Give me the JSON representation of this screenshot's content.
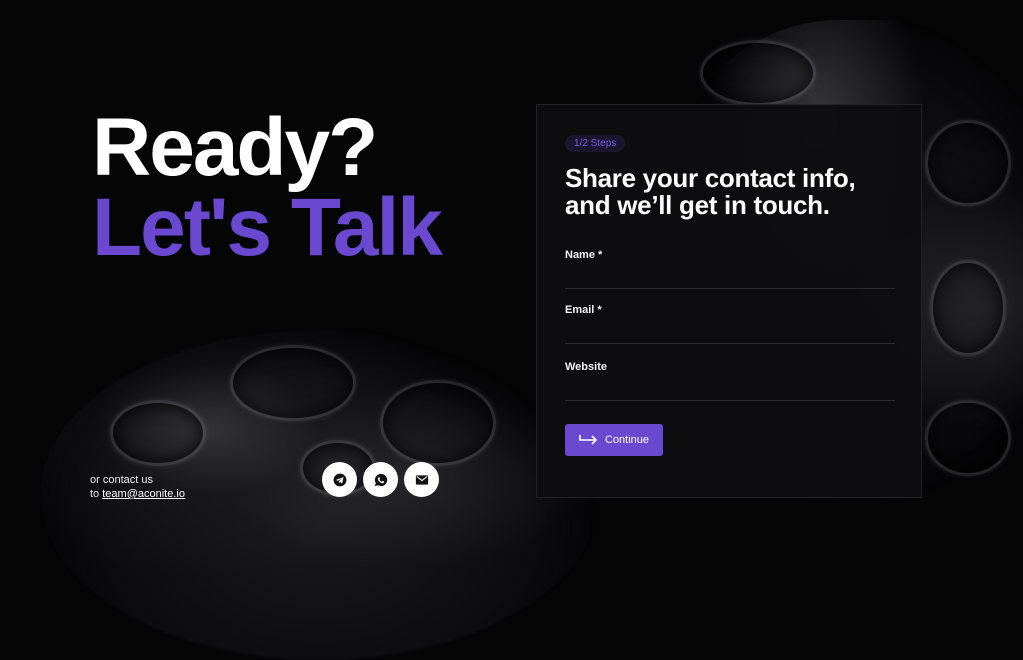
{
  "hero": {
    "line1": "Ready?",
    "line2": "Let's Talk"
  },
  "contact": {
    "prefix": "or contact us",
    "to": "to ",
    "email": "team@aconite.io"
  },
  "social": [
    {
      "icon": "telegram-icon"
    },
    {
      "icon": "whatsapp-icon"
    },
    {
      "icon": "mail-icon"
    }
  ],
  "form": {
    "steps": "1/2 Steps",
    "title": "Share your contact info, and we’ll get in touch.",
    "name_label": "Name *",
    "name_value": "",
    "email_label": "Email *",
    "email_value": "",
    "website_label": "Website",
    "website_value": "",
    "continue_label": "Continue"
  },
  "colors": {
    "accent": "#6a48d0",
    "background": "#050506",
    "card": "#0e0e10"
  }
}
